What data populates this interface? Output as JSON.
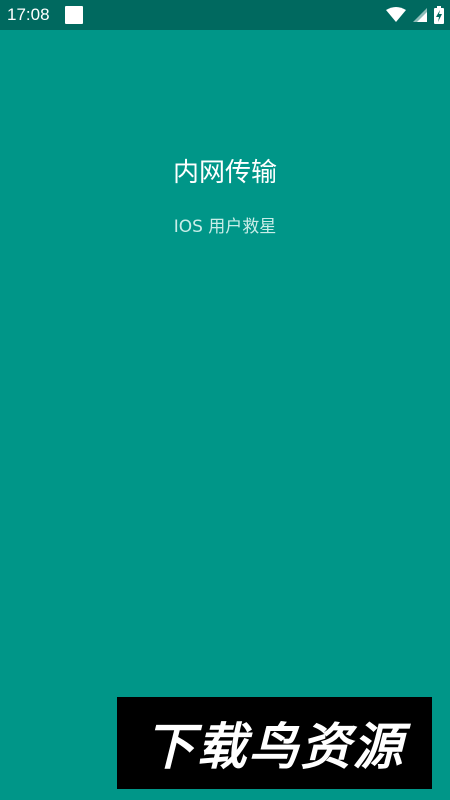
{
  "status_bar": {
    "time": "17:08"
  },
  "app": {
    "title": "内网传输",
    "subtitle": "IOS 用户救星"
  },
  "watermark": {
    "text": "下载鸟资源"
  },
  "colors": {
    "background": "#009688",
    "status_bar": "#00695f",
    "text_primary": "#ffffff",
    "text_secondary": "#c9ede8"
  }
}
